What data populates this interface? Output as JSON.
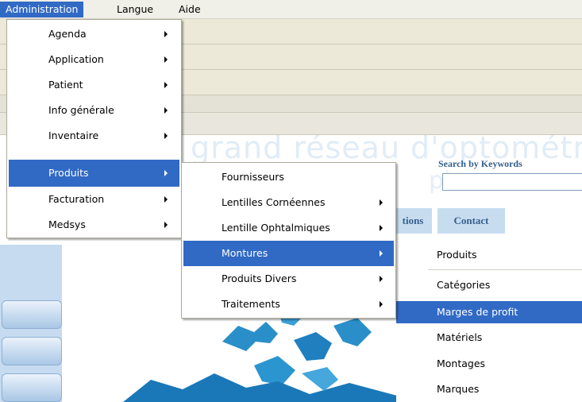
{
  "menubar": [
    {
      "label": "Administration",
      "active": true
    },
    {
      "label": "Langue",
      "active": false
    },
    {
      "label": "Aide",
      "active": false
    }
  ],
  "administration_menu": [
    {
      "label": "Agenda",
      "submenu": true
    },
    {
      "label": "Application",
      "submenu": true
    },
    {
      "label": "Patient",
      "submenu": true
    },
    {
      "label": "Info générale",
      "submenu": true
    },
    {
      "label": "Inventaire",
      "submenu": true
    },
    {
      "label": "Produits",
      "submenu": true,
      "selected": true
    },
    {
      "label": "Facturation",
      "submenu": true
    },
    {
      "label": "Medsys",
      "submenu": true
    }
  ],
  "produits_menu": [
    {
      "label": "Fournisseurs",
      "submenu": false
    },
    {
      "label": "Lentilles Cornéennes",
      "submenu": true
    },
    {
      "label": "Lentille Ophtalmiques",
      "submenu": true
    },
    {
      "label": "Montures",
      "submenu": true,
      "selected": true
    },
    {
      "label": "Produits Divers",
      "submenu": true
    },
    {
      "label": "Traitements",
      "submenu": true
    }
  ],
  "montures_menu": [
    {
      "label": "Produits"
    },
    {
      "label": "Catégories"
    },
    {
      "label": "Marges de profit",
      "selected": true
    },
    {
      "label": "Matériels"
    },
    {
      "label": "Montages"
    },
    {
      "label": "Marques"
    }
  ],
  "website": {
    "background_heading": "grand réseau d'optométr",
    "background_heading_2": "plus",
    "search_label": "Search by Keywords",
    "nav_partial": "tions",
    "nav_contact": "Contact"
  },
  "colors": {
    "highlight": "#316ac5",
    "menubar": "#f0efe8",
    "site_blue": "#35608f",
    "tab_bg": "#c8dcef"
  }
}
